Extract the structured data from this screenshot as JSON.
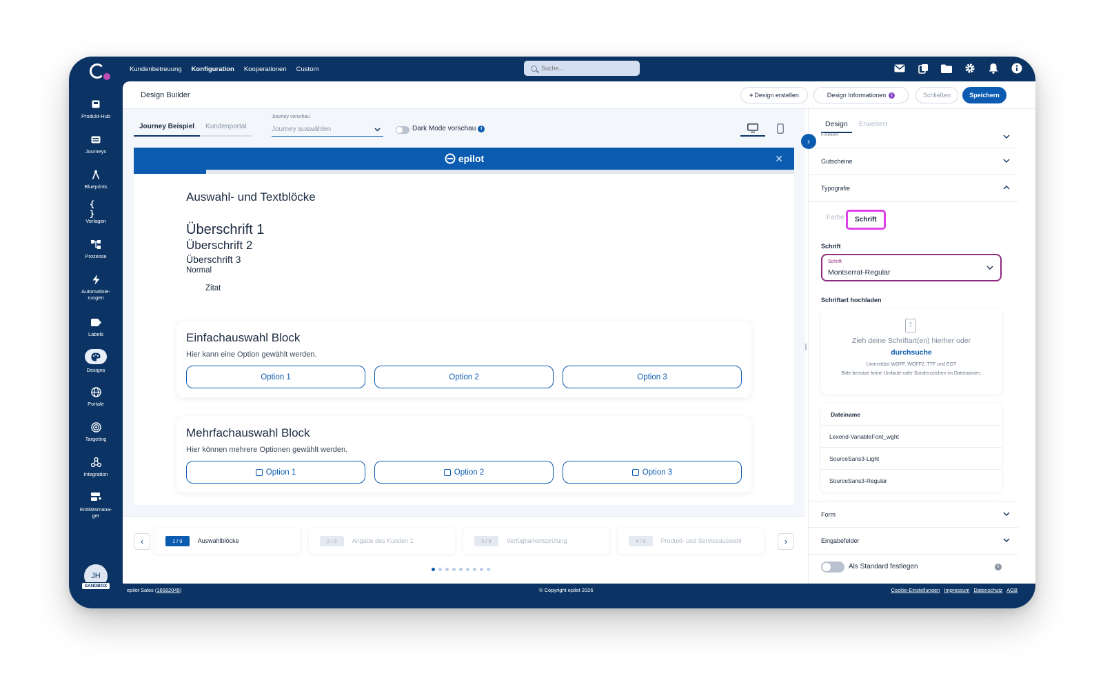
{
  "topnav": {
    "links": [
      "Kundenbetreuung",
      "Konfiguration",
      "Kooperationen",
      "Custom"
    ],
    "active_link": "Konfiguration",
    "search_placeholder": "Suche...",
    "icons": [
      "mail-icon",
      "copy-icon",
      "folder-icon",
      "gear-icon",
      "bell-icon",
      "info-icon"
    ]
  },
  "sidebar": {
    "items": [
      {
        "label": "Produkt-Hub",
        "icon": "product-hub-icon"
      },
      {
        "label": "Journeys",
        "icon": "journeys-icon"
      },
      {
        "label": "Blueprints",
        "icon": "blueprints-icon"
      },
      {
        "label": "Vorlagen",
        "icon": "templates-icon"
      },
      {
        "label": "Prozesse",
        "icon": "processes-icon"
      },
      {
        "label": "Automatisie-\nrungen",
        "icon": "bolt-icon"
      },
      {
        "label": "Labels",
        "icon": "label-icon"
      },
      {
        "label": "Designs",
        "icon": "palette-icon"
      },
      {
        "label": "Portale",
        "icon": "globe-icon"
      },
      {
        "label": "Targeting",
        "icon": "target-icon"
      },
      {
        "label": "Integration",
        "icon": "integration-icon"
      },
      {
        "label": "Entitätsmana-\nger",
        "icon": "entity-manager-icon"
      }
    ],
    "active": "Designs",
    "avatar_initials": "JH",
    "avatar_badge": "SANDBOX"
  },
  "header": {
    "title": "Design Builder",
    "create_label": "Design erstellen",
    "info_label": "Design Informationen",
    "close_label": "Schließen",
    "save_label": "Speichern"
  },
  "preview": {
    "tabs": [
      "Journey Beispiel",
      "Kundenportal"
    ],
    "active_tab": "Journey Beispiel",
    "journey_label": "Journey vorschau",
    "journey_placeholder": "Journey auswählen",
    "dark_mode_label": "Dark Mode vorschau",
    "brand": "epilot",
    "progress": 0.11,
    "block_title": "Auswahl- und Textblöcke",
    "h1": "Überschrift 1",
    "h2": "Überschrift 2",
    "h3": "Überschrift 3",
    "normal": "Normal",
    "quote": "Zitat",
    "single_title": "Einfachauswahl Block",
    "single_sub": "Hier kann eine Option gewählt werden.",
    "single_options": [
      "Option 1",
      "Option 2",
      "Option 3"
    ],
    "multi_title": "Mehrfachauswahl Block",
    "multi_sub": "Hier können mehrere Optionen gewählt werden.",
    "multi_options": [
      "Option 1",
      "Option 2",
      "Option 3"
    ]
  },
  "steps": {
    "items": [
      {
        "badge": "1 / 9",
        "label": "Auswahlblöcke"
      },
      {
        "badge": "2 / 9",
        "label": "Angabe des Kunden 1"
      },
      {
        "badge": "3 / 9",
        "label": "Verfügbarkeitsprüfung"
      },
      {
        "badge": "4 / 9",
        "label": "Produkt- und Serviceauswahl"
      }
    ],
    "active_index": 0,
    "dot_count": 9
  },
  "right_panel": {
    "tabs": [
      "Design",
      "Erweitert"
    ],
    "active_tab": "Design",
    "farben_label": "Farben",
    "gutscheine_label": "Gutscheine",
    "typografie_label": "Typografie",
    "typo_tabs": [
      "Farbe",
      "Schrift"
    ],
    "typo_active": "Schrift",
    "schrift_label": "Schrift",
    "select_small_label": "Schrift",
    "select_value": "Montserrat-Regular",
    "upload_label": "Schriftart hochladen",
    "dropzone_text": "Zieh deine Schriftart(en) hierher oder",
    "dropzone_link": "durchsuche",
    "dropzone_note_1": "Unterstützt WOFF, WOFF2, TTF und EOT",
    "dropzone_note_2": "Bitte benutze keine Umlaute oder Sonderzeichen im Dateinamen.",
    "file_header": "Dateiname",
    "files": [
      "Lexend-VariableFont_wght",
      "SourceSans3-Light",
      "SourceSans3-Regular"
    ],
    "form_label": "Form",
    "input_label": "Eingabefelder",
    "default_label": "Als Standard festlegen"
  },
  "footer": {
    "org": "epilot Sales",
    "org_id": "16582045",
    "copyright": "© Copyright epilot 2026",
    "links": [
      "Cookie-Einstellungen",
      "Impressum",
      "Datenschutz",
      "AGB"
    ]
  },
  "colors": {
    "navy": "#0b3464",
    "primary": "#0b5cb0",
    "highlight": "#e040e8",
    "select_border": "#8e2a7f"
  }
}
